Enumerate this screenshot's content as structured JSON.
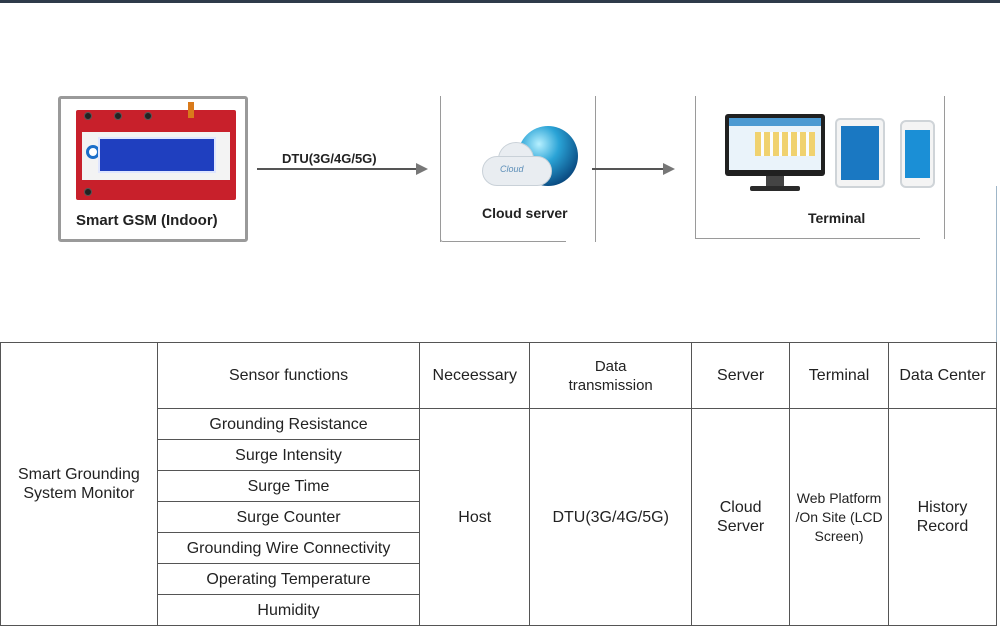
{
  "diagram": {
    "gsm_label": "Smart GSM (Indoor)",
    "link_label": "DTU(3G/4G/5G)",
    "cloud_label": "Cloud server",
    "cloud_logo_text": "Cloud",
    "terminal_label": "Terminal"
  },
  "table": {
    "row_title": "Smart Grounding System Monitor",
    "headers": {
      "sensor": "Sensor functions",
      "necessary": "Neceessary",
      "data_transmission": "Data transmission",
      "server": "Server",
      "terminal": "Terminal",
      "data_center": "Data Center"
    },
    "sensors": [
      "Grounding Resistance",
      "Surge Intensity",
      "Surge Time",
      "Surge Counter",
      "Grounding Wire Connectivity",
      "Operating Temperature",
      "Humidity"
    ],
    "necessary_value": "Host",
    "transmission_value": "DTU(3G/4G/5G)",
    "server_value": "Cloud Server",
    "terminal_value": "Web Platform /On Site (LCD Screen)",
    "data_center_value": "History Record"
  },
  "colors": {
    "device_red": "#c8202b",
    "screen_blue": "#1f3fbf",
    "border_gray": "#9a9a9a"
  }
}
